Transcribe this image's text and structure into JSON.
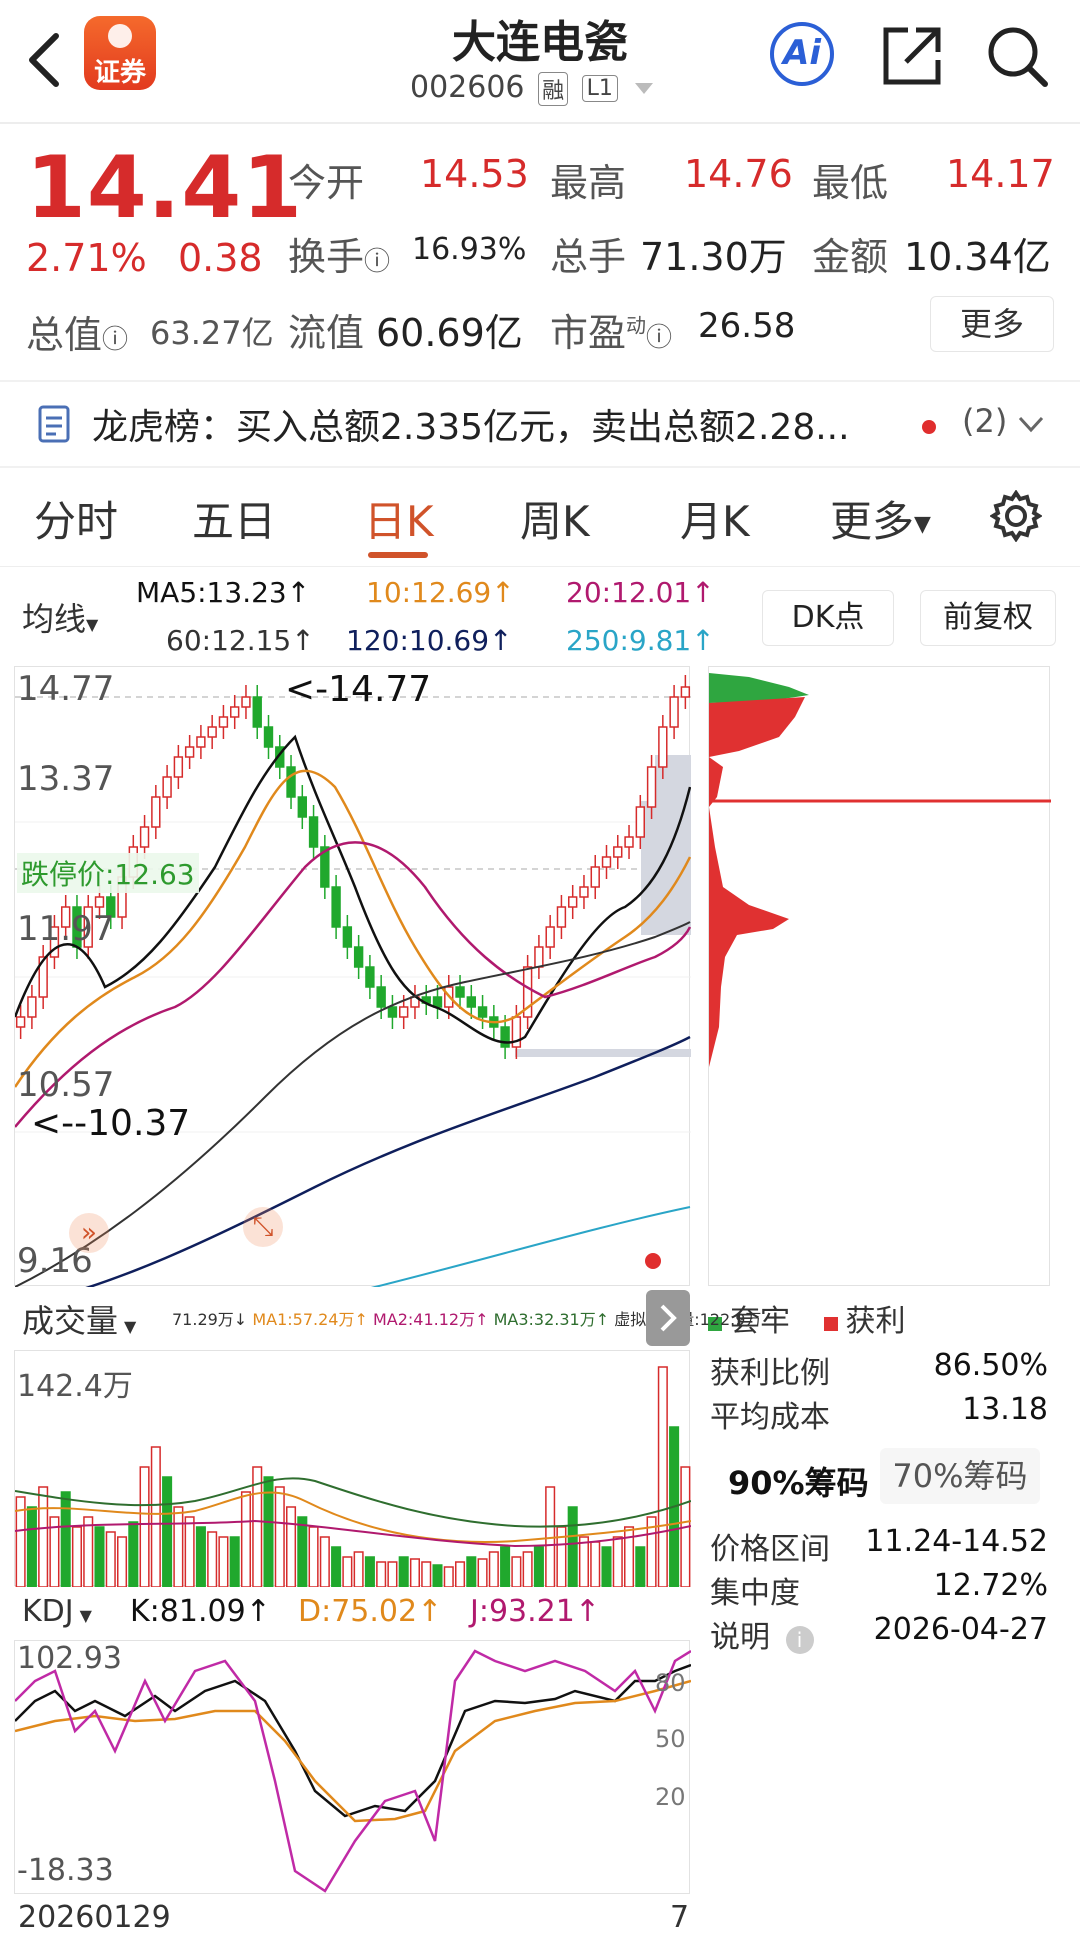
{
  "header": {
    "title": "大连电瓷",
    "code": "002606",
    "badge_rong": "融",
    "badge_level": "L1",
    "logo_text": "证券",
    "ai_label": "Ai"
  },
  "quote": {
    "price": "14.41",
    "change_pct": "2.71%",
    "change": "0.38",
    "open_label": "今开",
    "open": "14.53",
    "high_label": "最高",
    "high": "14.76",
    "low_label": "最低",
    "low": "14.17",
    "turnover_label": "换手",
    "turnover": "16.93%",
    "volume_label": "总手",
    "volume": "71.30万",
    "amount_label": "金额",
    "amount": "10.34亿",
    "mktcap_label": "总值",
    "mktcap": "63.27亿",
    "float_label": "流值",
    "float": "60.69亿",
    "pe_label": "市盈",
    "pe_sup": "动",
    "pe": "26.58",
    "more": "更多"
  },
  "notice": {
    "text": "龙虎榜：买入总额2.335亿元，卖出总额2.28...",
    "count": "(2)"
  },
  "tabs": [
    "分时",
    "五日",
    "日K",
    "周K",
    "月K",
    "更多"
  ],
  "active_tab": "日K",
  "ma": {
    "label": "均线",
    "ma5": "MA5:13.23↑",
    "ma10": "10:12.69↑",
    "ma20": "20:12.01↑",
    "ma60": "60:12.15↑",
    "ma120": "120:10.69↑",
    "ma250": "250:9.81↑",
    "dk": "DK点",
    "fuquan": "前复权"
  },
  "kline": {
    "y_labels": [
      "14.77",
      "13.37",
      "11.97",
      "10.57",
      "9.16"
    ],
    "max_mark": "<-14.77",
    "min_mark": "<--10.37",
    "limit_down": "跌停价:12.63"
  },
  "volume": {
    "label": "成交量",
    "info": "71.29万↓",
    "ma1": "MA1:57.24万↑",
    "ma2": "MA2:41.12万↑",
    "ma3": "MA3:32.31万↑",
    "virtual": "虚拟成交量:122.9万",
    "max": "142.4万"
  },
  "kdj": {
    "label": "KDJ",
    "k": "K:81.09↑",
    "d": "D:75.02↑",
    "j": "J:93.21↑",
    "max": "102.93",
    "min": "-18.33",
    "levels": [
      "80",
      "50",
      "20"
    ]
  },
  "date_start": "20260129",
  "date_end_partial": "7",
  "chips": {
    "legend_trapped": "套牢",
    "legend_profit": "获利",
    "profit_ratio_label": "获利比例",
    "profit_ratio": "86.50%",
    "avg_cost_label": "平均成本",
    "avg_cost": "13.18",
    "tab90": "90%筹码",
    "tab70": "70%筹码",
    "range_label": "价格区间",
    "range": "11.24-14.52",
    "concentration_label": "集中度",
    "concentration": "12.72%",
    "note_label": "说明",
    "note": "2026-04-27"
  },
  "colors": {
    "up": "#d62b2b",
    "down": "#20a82d",
    "accent": "#d0532a",
    "ma5": "#111111",
    "ma10": "#e0891c",
    "ma20": "#b0196e",
    "ma60": "#333333",
    "ma120": "#0f1f5c",
    "ma250": "#2aa5c7"
  }
}
